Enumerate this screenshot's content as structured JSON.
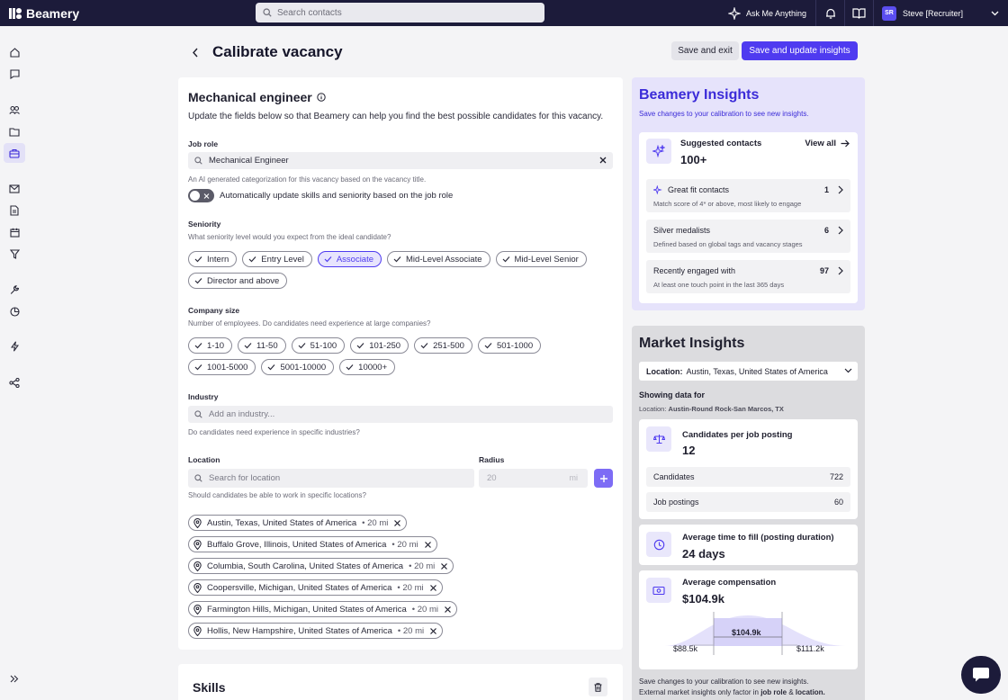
{
  "topbar": {
    "brand": "Beamery",
    "search_placeholder": "Search contacts",
    "ask_label": "Ask Me Anything",
    "user_initials": "SR",
    "user_name": "Steve [Recruiter]"
  },
  "header": {
    "title": "Calibrate vacancy",
    "save_exit": "Save and exit",
    "save_update": "Save and update insights"
  },
  "form": {
    "title": "Mechanical engineer",
    "subtitle": "Update the fields below so that Beamery can help you find the best possible candidates for this vacancy.",
    "job_role": {
      "label": "Job role",
      "value": "Mechanical Engineer",
      "hint": "An AI generated categorization for this vacancy based on the vacancy title.",
      "auto_update_label": "Automatically update skills and seniority based on the job role"
    },
    "seniority": {
      "label": "Seniority",
      "hint": "What seniority level would you expect from the ideal candidate?",
      "options": [
        {
          "label": "Intern",
          "selected": false
        },
        {
          "label": "Entry Level",
          "selected": false
        },
        {
          "label": "Associate",
          "selected": true
        },
        {
          "label": "Mid-Level Associate",
          "selected": false
        },
        {
          "label": "Mid-Level Senior",
          "selected": false
        },
        {
          "label": "Director and above",
          "selected": false
        }
      ]
    },
    "company_size": {
      "label": "Company size",
      "hint": "Number of employees. Do candidates need experience at large companies?",
      "options": [
        "1-10",
        "11-50",
        "51-100",
        "101-250",
        "251-500",
        "501-1000",
        "1001-5000",
        "5001-10000",
        "10000+"
      ]
    },
    "industry": {
      "label": "Industry",
      "placeholder": "Add an industry...",
      "hint": "Do candidates need experience in specific industries?"
    },
    "location": {
      "label": "Location",
      "placeholder": "Search for location",
      "hint": "Should candidates be able to work in specific locations?",
      "radius_label": "Radius",
      "radius_value": "20",
      "radius_unit": "mi",
      "items": [
        {
          "name": "Austin, Texas, United States of America",
          "dist": "20 mi"
        },
        {
          "name": "Buffalo Grove, Illinois, United States of America",
          "dist": "20 mi"
        },
        {
          "name": "Columbia, South Carolina, United States of America",
          "dist": "20 mi"
        },
        {
          "name": "Coopersville, Michigan, United States of America",
          "dist": "20 mi"
        },
        {
          "name": "Farmington Hills, Michigan, United States of America",
          "dist": "20 mi"
        },
        {
          "name": "Hollis, New Hampshire, United States of America",
          "dist": "20 mi"
        }
      ]
    },
    "skills_title": "Skills"
  },
  "insights": {
    "title": "Beamery Insights",
    "subtitle": "Save changes to your calibration to see new insights.",
    "suggested_label": "Suggested contacts",
    "suggested_value": "100+",
    "view_all": "View all",
    "rows": [
      {
        "title": "Great fit contacts",
        "count": "1",
        "sub": "Match score of 4* or above, most likely to engage"
      },
      {
        "title": "Silver medalists",
        "count": "6",
        "sub": "Defined based on global tags and vacancy stages"
      },
      {
        "title": "Recently engaged with",
        "count": "97",
        "sub": "At least one touch point in the last 365 days"
      }
    ]
  },
  "market": {
    "title": "Market Insights",
    "location_key": "Location:",
    "location_value": "Austin, Texas, United States of America",
    "showing_for": "Showing data for",
    "showing_loc_key": "Location:",
    "showing_loc_value": "Austin-Round Rock-San Marcos, TX",
    "cpp_label": "Candidates per job posting",
    "cpp_value": "12",
    "candidates_label": "Candidates",
    "candidates_value": "722",
    "postings_label": "Job postings",
    "postings_value": "60",
    "ttf_label": "Average time to fill (posting duration)",
    "ttf_value": "24 days",
    "comp_label": "Average compensation",
    "comp_value": "$104.9k",
    "comp_low": "$88.5k",
    "comp_mid": "$104.9k",
    "comp_high": "$111.2k",
    "note_line1": "Save changes to your calibration to see new insights.",
    "note_line2_pre": "External market insights only factor in",
    "note_line2_role": "job role",
    "note_line2_amp": "&",
    "note_line2_loc": "location."
  },
  "colors": {
    "accent": "#4f3bf0",
    "topbar": "#1c1b3a"
  }
}
